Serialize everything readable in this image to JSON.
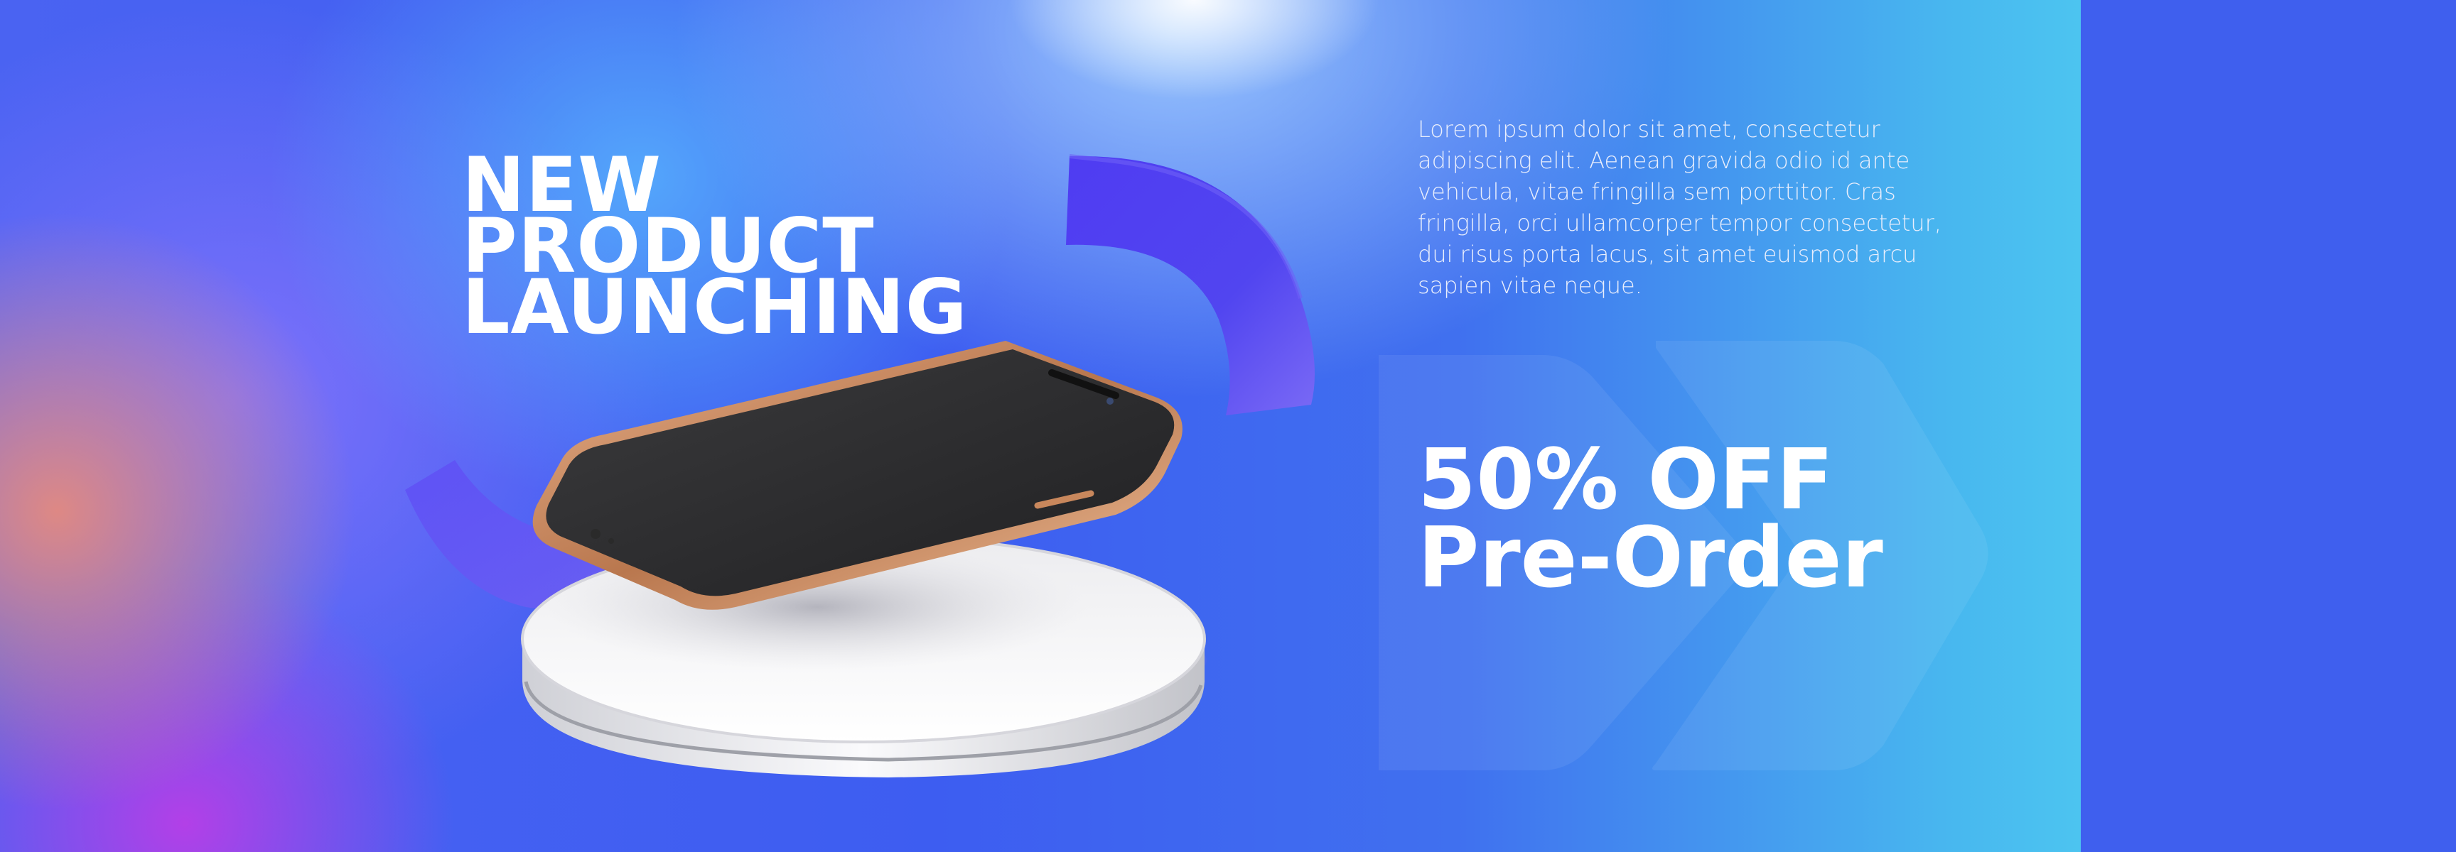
{
  "banner": {
    "headline": [
      "NEW",
      "PRODUCT",
      "LAUNCHING"
    ],
    "body_text": "Lorem ipsum dolor sit amet, consectetur adipiscing elit. Aenean gravida odio id ante vehicula, vitae fringilla sem porttitor. Cras fringilla, orci ullamcorper tempor consectetur, dui risus porta lacus, sit amet euismod arcu sapien vitae neque.",
    "offer": [
      "50% OFF",
      "Pre-Order"
    ]
  },
  "colors": {
    "background_blue": "#4a63f2",
    "cyan_edge": "#4cc4f0",
    "ribbon": "#4b3ff0",
    "side_strip": "#3f5fee",
    "phone_frame": "#c98a5e",
    "podium": "#f2f2f4"
  },
  "icons": [
    "chevron-arrow-icon",
    "smartphone-icon",
    "podium-icon",
    "ribbon-shape-icon"
  ]
}
